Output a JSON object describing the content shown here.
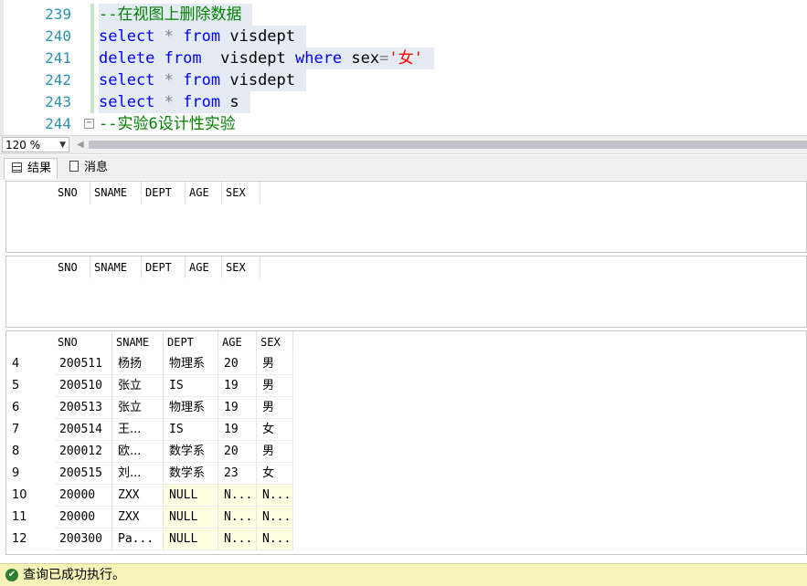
{
  "editor": {
    "lines": [
      {
        "no": "239",
        "segments": [
          {
            "t": "--在视图上删除数据",
            "c": "cmt"
          }
        ],
        "sel": true,
        "fold": false
      },
      {
        "no": "240",
        "segments": [
          {
            "t": "select",
            "c": "kw"
          },
          {
            "t": " ",
            "c": "plain"
          },
          {
            "t": "*",
            "c": "op"
          },
          {
            "t": " ",
            "c": "plain"
          },
          {
            "t": "from",
            "c": "kw"
          },
          {
            "t": " visdept",
            "c": "plain"
          }
        ],
        "sel": true,
        "fold": false
      },
      {
        "no": "241",
        "segments": [
          {
            "t": "delete",
            "c": "kw"
          },
          {
            "t": " ",
            "c": "plain"
          },
          {
            "t": "from",
            "c": "kw"
          },
          {
            "t": "  visdept ",
            "c": "plain"
          },
          {
            "t": "where",
            "c": "kw"
          },
          {
            "t": " sex",
            "c": "plain"
          },
          {
            "t": "=",
            "c": "op"
          },
          {
            "t": "'女'",
            "c": "str"
          }
        ],
        "sel": true,
        "fold": false
      },
      {
        "no": "242",
        "segments": [
          {
            "t": "select",
            "c": "kw"
          },
          {
            "t": " ",
            "c": "plain"
          },
          {
            "t": "*",
            "c": "op"
          },
          {
            "t": " ",
            "c": "plain"
          },
          {
            "t": "from",
            "c": "kw"
          },
          {
            "t": " visdept",
            "c": "plain"
          }
        ],
        "sel": true,
        "fold": false
      },
      {
        "no": "243",
        "segments": [
          {
            "t": "select",
            "c": "kw"
          },
          {
            "t": " ",
            "c": "plain"
          },
          {
            "t": "*",
            "c": "op"
          },
          {
            "t": " ",
            "c": "plain"
          },
          {
            "t": "from",
            "c": "kw"
          },
          {
            "t": " s",
            "c": "plain"
          }
        ],
        "sel": true,
        "fold": false
      },
      {
        "no": "244",
        "segments": [
          {
            "t": "--实验6设计性实验",
            "c": "cmt"
          }
        ],
        "sel": false,
        "fold": true
      }
    ]
  },
  "zoom": {
    "value": "120 %"
  },
  "tabs": {
    "results": "结果",
    "messages": "消息"
  },
  "grids": [
    {
      "columns": [
        "SNO",
        "SNAME",
        "DEPT",
        "AGE",
        "SEX"
      ],
      "rows": []
    },
    {
      "columns": [
        "SNO",
        "SNAME",
        "DEPT",
        "AGE",
        "SEX"
      ],
      "rows": []
    },
    {
      "columns": [
        "SNO",
        "SNAME",
        "DEPT",
        "AGE",
        "SEX"
      ],
      "rows": [
        {
          "n": "4",
          "cells": [
            "200511",
            "杨扬",
            "物理系",
            "20",
            "男"
          ]
        },
        {
          "n": "5",
          "cells": [
            "200510",
            "张立",
            "IS",
            "19",
            "男"
          ]
        },
        {
          "n": "6",
          "cells": [
            "200513",
            "张立",
            "物理系",
            "19",
            "男"
          ]
        },
        {
          "n": "7",
          "cells": [
            "200514",
            "王...",
            "IS",
            "19",
            "女"
          ]
        },
        {
          "n": "8",
          "cells": [
            "200012",
            "欧...",
            "数学系",
            "20",
            "男"
          ]
        },
        {
          "n": "9",
          "cells": [
            "200515",
            "刘...",
            "数学系",
            "23",
            "女"
          ]
        },
        {
          "n": "10",
          "cells": [
            "20000",
            "ZXX",
            "NULL",
            "N...",
            "N..."
          ]
        },
        {
          "n": "11",
          "cells": [
            "20000",
            "ZXX",
            "NULL",
            "N...",
            "N..."
          ]
        },
        {
          "n": "12",
          "cells": [
            "200300",
            "Pa...",
            "NULL",
            "N...",
            "N..."
          ]
        }
      ]
    }
  ],
  "status": {
    "text": "查询已成功执行。",
    "icon": "check-circle-icon"
  }
}
